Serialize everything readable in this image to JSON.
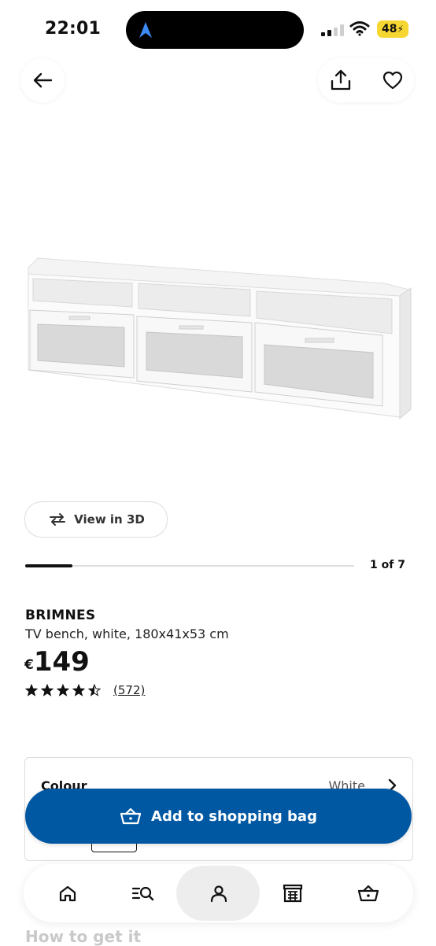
{
  "status_bar": {
    "time": "22:01",
    "battery": "48",
    "icons": [
      "location-arrow-icon",
      "signal-icon",
      "wifi-icon",
      "battery-charging-icon"
    ]
  },
  "header": {
    "back_icon": "arrow-left-icon",
    "share_icon": "share-icon",
    "favourite_icon": "heart-icon"
  },
  "gallery": {
    "view3d_label": "View in 3D",
    "counter": "1 of 7",
    "progress": 0.143
  },
  "product": {
    "name": "BRIMNES",
    "description": "TV bench, white, 180x41x53 cm",
    "currency": "€",
    "price": "149",
    "rating": 4.5,
    "reviews": "(572)"
  },
  "options": {
    "colour_label": "Colour",
    "colour_value": "White"
  },
  "cta": {
    "add_label": "Add to shopping bag"
  },
  "section": {
    "how_to_get": "How to get it"
  },
  "bottom_nav": {
    "items": [
      "home-icon",
      "search-icon",
      "account-icon",
      "store-icon",
      "basket-icon"
    ],
    "active": "account-icon"
  },
  "colors": {
    "accent": "#0058a3",
    "battery": "#f6d631"
  }
}
